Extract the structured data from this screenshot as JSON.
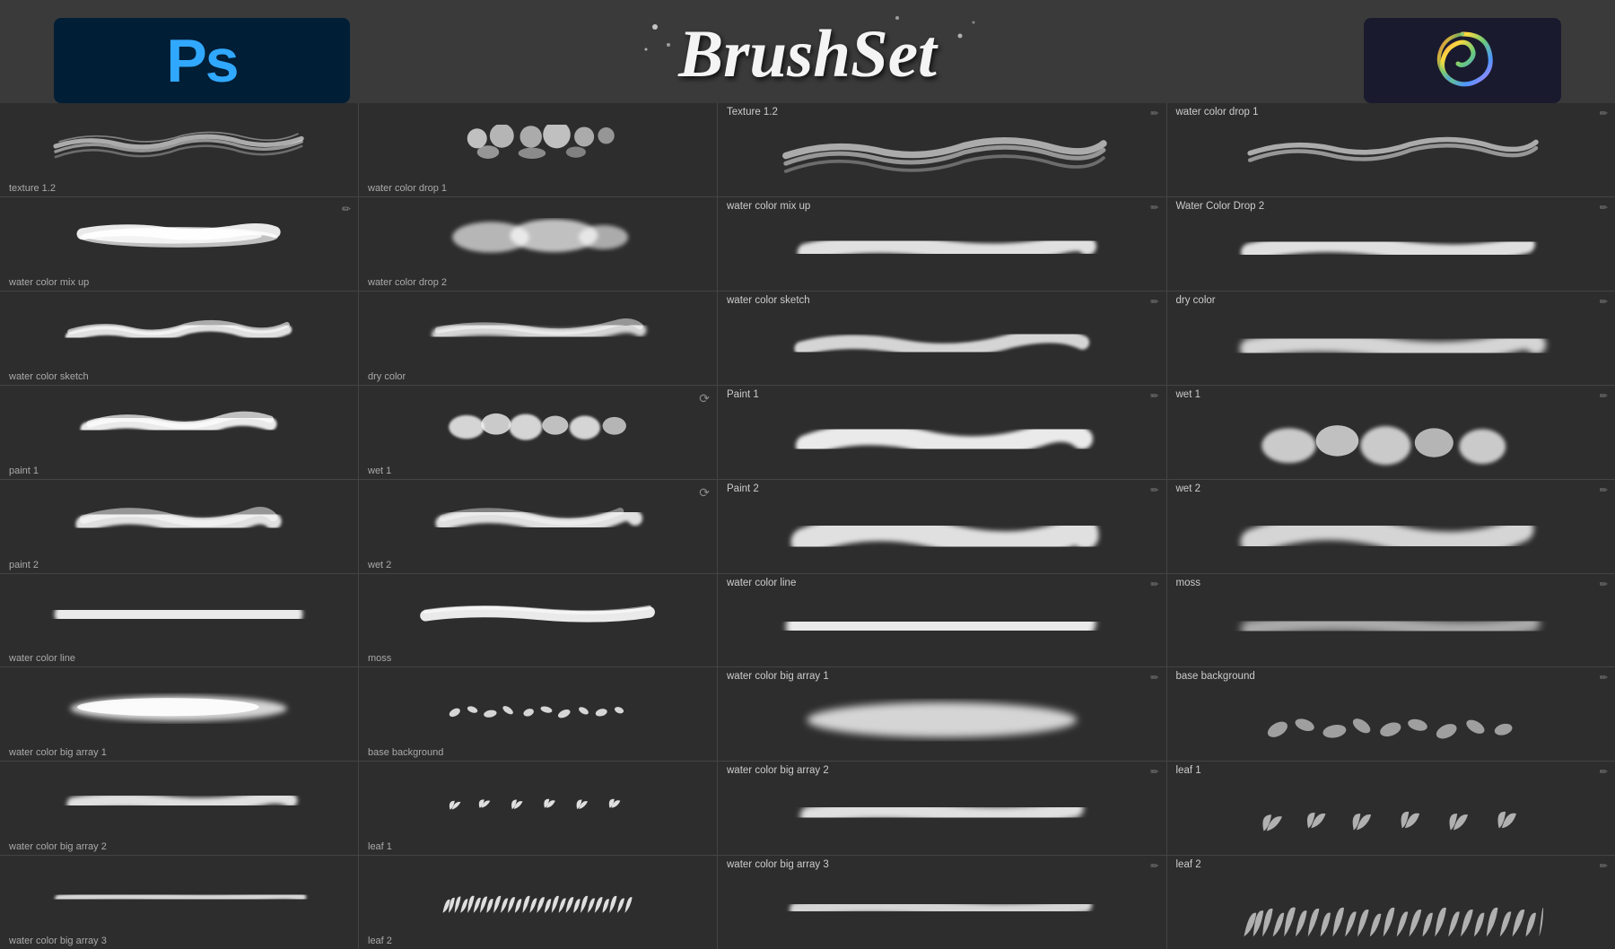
{
  "header": {
    "ps_label": "Ps",
    "title": "BrushSet",
    "procreate_alt": "Procreate Logo"
  },
  "left_panel": {
    "brushes": [
      {
        "id": "texture-1-2",
        "label": "texture 1.2",
        "stroke": "wavy-lines"
      },
      {
        "id": "water-color-mix-up",
        "label": "water color mix up",
        "stroke": "thick-soft"
      },
      {
        "id": "water-color-sketch",
        "label": "water color sketch",
        "stroke": "rough-edge"
      },
      {
        "id": "paint-1",
        "label": "paint 1",
        "stroke": "splat-wide"
      },
      {
        "id": "paint-2",
        "label": "paint 2",
        "stroke": "furry-wide"
      },
      {
        "id": "water-color-line",
        "label": "water color line",
        "stroke": "thin-wavy"
      },
      {
        "id": "water-color-big-array-1",
        "label": "water color big array 1",
        "stroke": "soft-wide"
      },
      {
        "id": "water-color-big-array-2",
        "label": "water color big array 2",
        "stroke": "medium-wide"
      },
      {
        "id": "water-color-big-array-3-left",
        "label": "water color big array 3",
        "stroke": "thin-long"
      }
    ]
  },
  "middle_panel": {
    "brushes": [
      {
        "id": "water-color-drop-1",
        "label": "water color drop 1",
        "stroke": "droplets"
      },
      {
        "id": "water-color-drop-2",
        "label": "water color drop 2",
        "stroke": "blobs"
      },
      {
        "id": "dry-color",
        "label": "dry color",
        "stroke": "dry-rough"
      },
      {
        "id": "wet-1",
        "label": "wet 1",
        "stroke": "dotted-blobs",
        "has_icon": true
      },
      {
        "id": "wet-2",
        "label": "wet 2",
        "stroke": "hairy-wide",
        "has_icon": true
      },
      {
        "id": "moss",
        "label": "moss",
        "stroke": "wavy-smooth"
      },
      {
        "id": "base-background",
        "label": "base background",
        "stroke": "leaf-scatter"
      },
      {
        "id": "leaf-1",
        "label": "leaf 1",
        "stroke": "leaf-row"
      },
      {
        "id": "leaf-2",
        "label": "leaf 2",
        "stroke": "dense-leaves"
      }
    ]
  },
  "right_col_1": {
    "brushes": [
      {
        "id": "r-texture-1-2",
        "label": "Texture 1.2",
        "stroke": "wavy-lines"
      },
      {
        "id": "r-water-color-mix-up",
        "label": "water color mix up",
        "stroke": "thick-soft"
      },
      {
        "id": "r-water-color-sketch",
        "label": "water color sketch",
        "stroke": "rough-edge"
      },
      {
        "id": "r-paint-1",
        "label": "Paint 1",
        "stroke": "splat-wide"
      },
      {
        "id": "r-paint-2",
        "label": "Paint 2",
        "stroke": "furry-wide"
      },
      {
        "id": "r-water-color-line",
        "label": "water color line",
        "stroke": "thin-wavy"
      },
      {
        "id": "r-water-color-big-array-1",
        "label": "water color big array 1",
        "stroke": "soft-wide"
      },
      {
        "id": "r-water-color-big-array-2",
        "label": "water color big array 2",
        "stroke": "medium-wide"
      },
      {
        "id": "r-water-color-big-array-3",
        "label": "water color big array 3",
        "stroke": "thin-long"
      }
    ]
  },
  "right_col_2": {
    "brushes": [
      {
        "id": "r-water-color-drop-1",
        "label": "water color drop 1",
        "stroke": "wavy-lines"
      },
      {
        "id": "r-water-color-drop-2",
        "label": "Water Color Drop 2",
        "stroke": "thick-soft"
      },
      {
        "id": "r-dry-color",
        "label": "dry color",
        "stroke": "rough-edge"
      },
      {
        "id": "r-wet-1",
        "label": "wet 1",
        "stroke": "dotted-blobs"
      },
      {
        "id": "r-wet-2",
        "label": "wet 2",
        "stroke": "hairy-wide"
      },
      {
        "id": "r-moss",
        "label": "moss",
        "stroke": "wavy-smooth"
      },
      {
        "id": "r-base-background",
        "label": "base background",
        "stroke": "leaf-scatter"
      },
      {
        "id": "r-leaf-1",
        "label": "leaf 1",
        "stroke": "leaf-row"
      },
      {
        "id": "r-leaf-2",
        "label": "leaf 2",
        "stroke": "dense-leaves"
      }
    ]
  },
  "colors": {
    "bg_dark": "#2d2d2d",
    "bg_darker": "#252525",
    "ps_blue": "#31a8ff",
    "ps_bg": "#001e36",
    "border": "#444444",
    "text_label": "#aaaaaa",
    "text_header": "#cccccc"
  }
}
